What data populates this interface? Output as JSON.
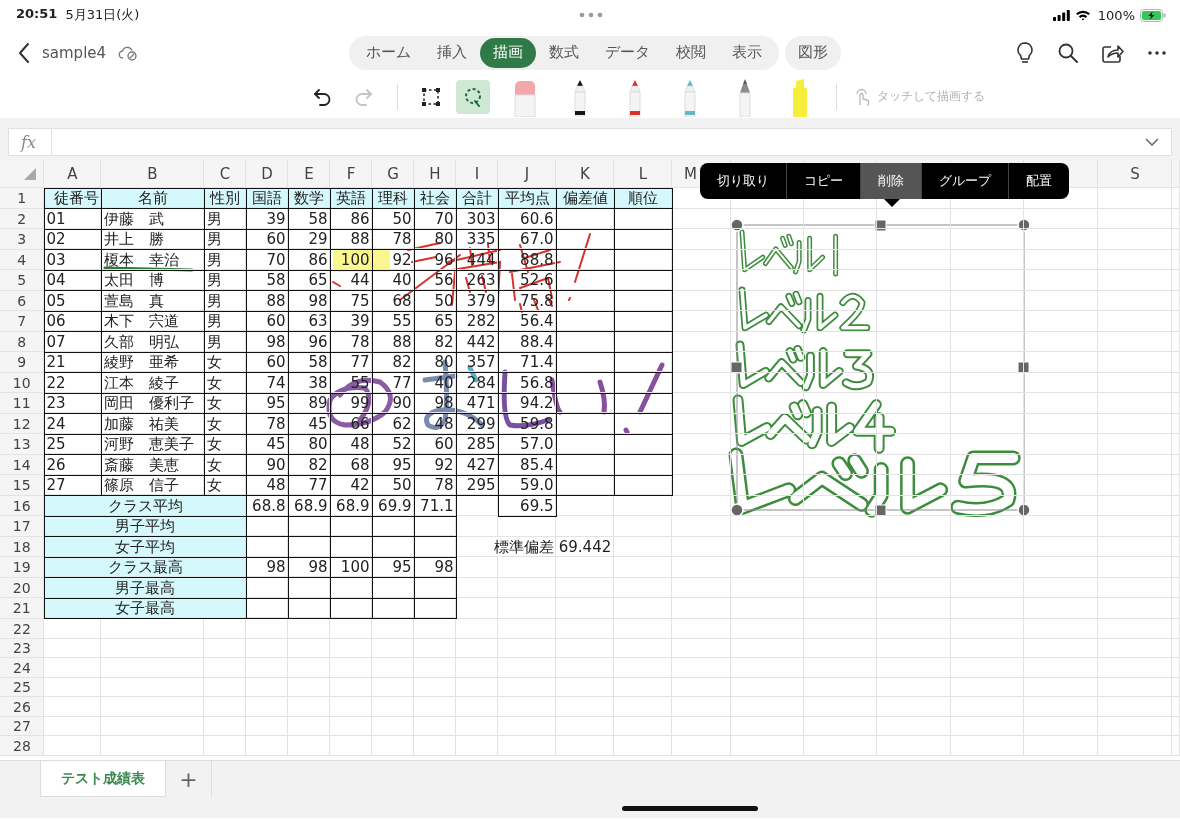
{
  "status_bar": {
    "time": "20:51",
    "date": "5月31日(火)",
    "battery": "100%"
  },
  "title_bar": {
    "file_name": "sample4"
  },
  "ribbon_tabs": [
    {
      "label": "ホーム",
      "selected": false
    },
    {
      "label": "挿入",
      "selected": false
    },
    {
      "label": "描画",
      "selected": true
    },
    {
      "label": "数式",
      "selected": false
    },
    {
      "label": "データ",
      "selected": false
    },
    {
      "label": "校閲",
      "selected": false
    },
    {
      "label": "表示",
      "selected": false
    }
  ],
  "context_tabs": [
    {
      "label": "図形",
      "selected": false
    }
  ],
  "draw_toolbar": {
    "tools": [
      {
        "kind": "undo",
        "disabled": false
      },
      {
        "kind": "redo",
        "disabled": true
      },
      {
        "kind": "select",
        "selected": false
      },
      {
        "kind": "lasso",
        "selected": true
      }
    ],
    "pens": [
      {
        "kind": "eraser",
        "color": "#f2a7ab"
      },
      {
        "kind": "pen",
        "color": "#151515"
      },
      {
        "kind": "pen",
        "color": "#d9302c"
      },
      {
        "kind": "pen",
        "color": "#62b9c6"
      },
      {
        "kind": "pencil",
        "color": "#8c8c8c"
      },
      {
        "kind": "highlighter",
        "color": "#f6ee3c"
      }
    ],
    "touch_draw": {
      "label": "タッチして描画する",
      "disabled": true
    }
  },
  "formula_bar": {
    "label": "fx"
  },
  "sheet": {
    "column_headers": [
      "A",
      "B",
      "C",
      "D",
      "E",
      "F",
      "G",
      "H",
      "I",
      "J",
      "K",
      "L",
      "M",
      "S"
    ],
    "rows": [
      {
        "number": "1",
        "kind": "header",
        "cells": [
          "徒番号",
          "名前",
          "性別",
          "国語",
          "数学",
          "英語",
          "理科",
          "社会",
          "合計",
          "平均点",
          "偏差値",
          "順位"
        ]
      },
      {
        "number": "2",
        "kind": "record",
        "cells": [
          "01",
          "伊藤　武",
          "男",
          "39",
          "58",
          "86",
          "50",
          "70",
          "303",
          "60.6"
        ]
      },
      {
        "number": "3",
        "kind": "record",
        "cells": [
          "02",
          "井上　勝",
          "男",
          "60",
          "29",
          "88",
          "78",
          "80",
          "335",
          "67.0"
        ]
      },
      {
        "number": "4",
        "kind": "record",
        "cells": [
          "03",
          "榎本　幸治",
          "男",
          "70",
          "86",
          "100",
          "92",
          "96",
          "444",
          "88.8"
        ]
      },
      {
        "number": "5",
        "kind": "record",
        "cells": [
          "04",
          "太田　博",
          "男",
          "58",
          "65",
          "44",
          "40",
          "56",
          "263",
          "52.6"
        ]
      },
      {
        "number": "6",
        "kind": "record",
        "cells": [
          "05",
          "萱島　真",
          "男",
          "88",
          "98",
          "75",
          "68",
          "50",
          "379",
          "75.8"
        ]
      },
      {
        "number": "7",
        "kind": "record",
        "cells": [
          "06",
          "木下　宍道",
          "男",
          "60",
          "63",
          "39",
          "55",
          "65",
          "282",
          "56.4"
        ]
      },
      {
        "number": "8",
        "kind": "record",
        "cells": [
          "07",
          "久部　明弘",
          "男",
          "98",
          "96",
          "78",
          "88",
          "82",
          "442",
          "88.4"
        ]
      },
      {
        "number": "9",
        "kind": "record",
        "cells": [
          "21",
          "綾野　亜希",
          "女",
          "60",
          "58",
          "77",
          "82",
          "80",
          "357",
          "71.4"
        ]
      },
      {
        "number": "10",
        "kind": "record",
        "cells": [
          "22",
          "江本　綾子",
          "女",
          "74",
          "38",
          "55",
          "77",
          "40",
          "284",
          "56.8"
        ]
      },
      {
        "number": "11",
        "kind": "record",
        "cells": [
          "23",
          "岡田　優利子",
          "女",
          "95",
          "89",
          "99",
          "90",
          "98",
          "471",
          "94.2"
        ]
      },
      {
        "number": "12",
        "kind": "record",
        "cells": [
          "24",
          "加藤　祐美",
          "女",
          "78",
          "45",
          "66",
          "62",
          "48",
          "299",
          "59.8"
        ]
      },
      {
        "number": "13",
        "kind": "record",
        "cells": [
          "25",
          "河野　恵美子",
          "女",
          "45",
          "80",
          "48",
          "52",
          "60",
          "285",
          "57.0"
        ]
      },
      {
        "number": "14",
        "kind": "record",
        "cells": [
          "26",
          "斎藤　美恵",
          "女",
          "90",
          "82",
          "68",
          "95",
          "92",
          "427",
          "85.4"
        ]
      },
      {
        "number": "15",
        "kind": "record",
        "cells": [
          "27",
          "篠原　信子",
          "女",
          "48",
          "77",
          "42",
          "50",
          "78",
          "295",
          "59.0"
        ]
      },
      {
        "number": "16",
        "kind": "summary",
        "label": "クラス平均",
        "values": [
          "68.8",
          "68.9",
          "68.9",
          "69.9",
          "71.1"
        ],
        "average": "69.5"
      },
      {
        "number": "17",
        "kind": "summary",
        "label": "男子平均"
      },
      {
        "number": "18",
        "kind": "summary",
        "label": "女子平均",
        "note_label": "標準偏差",
        "note_value": "69.442"
      },
      {
        "number": "19",
        "kind": "summary",
        "label": "クラス最高",
        "values": [
          "98",
          "98",
          "100",
          "95",
          "98"
        ]
      },
      {
        "number": "20",
        "kind": "summary",
        "label": "男子最高"
      },
      {
        "number": "21",
        "kind": "summary",
        "label": "女子最高"
      },
      {
        "number": "22",
        "kind": "blank"
      },
      {
        "number": "23",
        "kind": "blank"
      },
      {
        "number": "24",
        "kind": "blank"
      },
      {
        "number": "25",
        "kind": "blank"
      },
      {
        "number": "26",
        "kind": "blank"
      },
      {
        "number": "27",
        "kind": "blank"
      },
      {
        "number": "28",
        "kind": "blank"
      }
    ]
  },
  "context_menu": {
    "items": [
      {
        "label": "切り取り",
        "selected": false
      },
      {
        "label": "コピー",
        "selected": false
      },
      {
        "label": "削除",
        "selected": true
      },
      {
        "label": "グループ",
        "selected": false
      },
      {
        "label": "配置",
        "selected": false
      }
    ]
  },
  "sheet_tabs": [
    {
      "label": "テスト成績表",
      "selected": true
    }
  ],
  "add_sheet": {
    "label": "+"
  }
}
